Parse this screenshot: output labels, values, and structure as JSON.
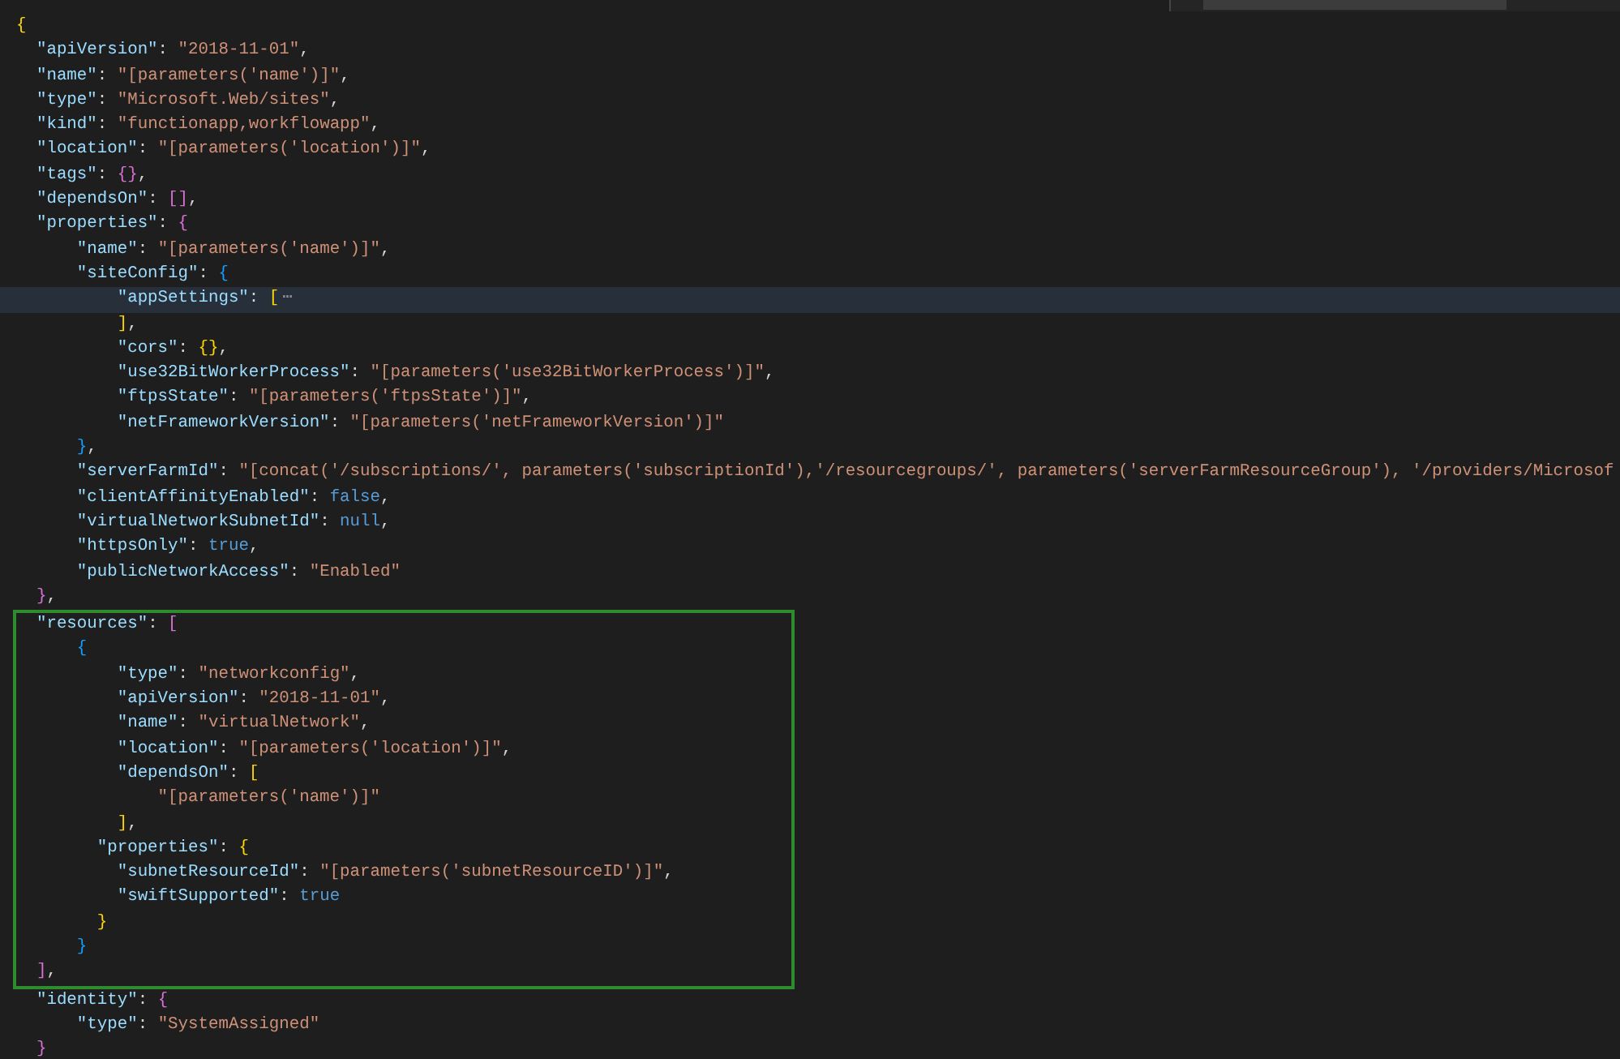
{
  "editor": {
    "lines_before": [
      {
        "current": false,
        "tokens": [
          {
            "kind": "b1",
            "text": "{"
          }
        ]
      },
      {
        "current": false,
        "tokens": [
          {
            "kind": "key",
            "text": "  \"apiVersion\""
          },
          {
            "kind": "p",
            "text": ": "
          },
          {
            "kind": "str",
            "text": "\"2018-11-01\""
          },
          {
            "kind": "p",
            "text": ","
          }
        ]
      },
      {
        "current": false,
        "tokens": [
          {
            "kind": "key",
            "text": "  \"name\""
          },
          {
            "kind": "p",
            "text": ": "
          },
          {
            "kind": "str",
            "text": "\"[parameters('name')]\""
          },
          {
            "kind": "p",
            "text": ","
          }
        ]
      },
      {
        "current": false,
        "tokens": [
          {
            "kind": "key",
            "text": "  \"type\""
          },
          {
            "kind": "p",
            "text": ": "
          },
          {
            "kind": "str",
            "text": "\"Microsoft.Web/sites\""
          },
          {
            "kind": "p",
            "text": ","
          }
        ]
      },
      {
        "current": false,
        "tokens": [
          {
            "kind": "key",
            "text": "  \"kind\""
          },
          {
            "kind": "p",
            "text": ": "
          },
          {
            "kind": "str",
            "text": "\"functionapp,workflowapp\""
          },
          {
            "kind": "p",
            "text": ","
          }
        ]
      },
      {
        "current": false,
        "tokens": [
          {
            "kind": "key",
            "text": "  \"location\""
          },
          {
            "kind": "p",
            "text": ": "
          },
          {
            "kind": "str",
            "text": "\"[parameters('location')]\""
          },
          {
            "kind": "p",
            "text": ","
          }
        ]
      },
      {
        "current": false,
        "tokens": [
          {
            "kind": "key",
            "text": "  \"tags\""
          },
          {
            "kind": "p",
            "text": ": "
          },
          {
            "kind": "b2",
            "text": "{}"
          },
          {
            "kind": "p",
            "text": ","
          }
        ]
      },
      {
        "current": false,
        "tokens": [
          {
            "kind": "key",
            "text": "  \"dependsOn\""
          },
          {
            "kind": "p",
            "text": ": "
          },
          {
            "kind": "b2",
            "text": "[]"
          },
          {
            "kind": "p",
            "text": ","
          }
        ]
      },
      {
        "current": false,
        "tokens": [
          {
            "kind": "key",
            "text": "  \"properties\""
          },
          {
            "kind": "p",
            "text": ": "
          },
          {
            "kind": "b2",
            "text": "{"
          }
        ]
      },
      {
        "current": false,
        "tokens": [
          {
            "kind": "key",
            "text": "      \"name\""
          },
          {
            "kind": "p",
            "text": ": "
          },
          {
            "kind": "str",
            "text": "\"[parameters('name')]\""
          },
          {
            "kind": "p",
            "text": ","
          }
        ]
      },
      {
        "current": false,
        "tokens": [
          {
            "kind": "key",
            "text": "      \"siteConfig\""
          },
          {
            "kind": "p",
            "text": ": "
          },
          {
            "kind": "b3",
            "text": "{"
          }
        ]
      },
      {
        "current": true,
        "tokens": [
          {
            "kind": "key",
            "text": "          \"appSettings\""
          },
          {
            "kind": "p",
            "text": ": "
          },
          {
            "kind": "b1",
            "text": "["
          },
          {
            "kind": "fold",
            "text": "⋯"
          }
        ]
      },
      {
        "current": false,
        "tokens": [
          {
            "kind": "b1",
            "text": "          ]"
          },
          {
            "kind": "p",
            "text": ","
          }
        ]
      },
      {
        "current": false,
        "tokens": [
          {
            "kind": "key",
            "text": "          \"cors\""
          },
          {
            "kind": "p",
            "text": ": "
          },
          {
            "kind": "b1",
            "text": "{}"
          },
          {
            "kind": "p",
            "text": ","
          }
        ]
      },
      {
        "current": false,
        "tokens": [
          {
            "kind": "key",
            "text": "          \"use32BitWorkerProcess\""
          },
          {
            "kind": "p",
            "text": ": "
          },
          {
            "kind": "str",
            "text": "\"[parameters('use32BitWorkerProcess')]\""
          },
          {
            "kind": "p",
            "text": ","
          }
        ]
      },
      {
        "current": false,
        "tokens": [
          {
            "kind": "key",
            "text": "          \"ftpsState\""
          },
          {
            "kind": "p",
            "text": ": "
          },
          {
            "kind": "str",
            "text": "\"[parameters('ftpsState')]\""
          },
          {
            "kind": "p",
            "text": ","
          }
        ]
      },
      {
        "current": false,
        "tokens": [
          {
            "kind": "key",
            "text": "          \"netFrameworkVersion\""
          },
          {
            "kind": "p",
            "text": ": "
          },
          {
            "kind": "str",
            "text": "\"[parameters('netFrameworkVersion')]\""
          }
        ]
      },
      {
        "current": false,
        "tokens": [
          {
            "kind": "b3",
            "text": "      }"
          },
          {
            "kind": "p",
            "text": ","
          }
        ]
      },
      {
        "current": false,
        "tokens": [
          {
            "kind": "key",
            "text": "      \"serverFarmId\""
          },
          {
            "kind": "p",
            "text": ": "
          },
          {
            "kind": "str",
            "text": "\"[concat('/subscriptions/', parameters('subscriptionId'),'/resourcegroups/', parameters('serverFarmResourceGroup'), '/providers/Microsof"
          }
        ]
      },
      {
        "current": false,
        "tokens": [
          {
            "kind": "key",
            "text": "      \"clientAffinityEnabled\""
          },
          {
            "kind": "p",
            "text": ": "
          },
          {
            "kind": "kw",
            "text": "false"
          },
          {
            "kind": "p",
            "text": ","
          }
        ]
      },
      {
        "current": false,
        "tokens": [
          {
            "kind": "key",
            "text": "      \"virtualNetworkSubnetId\""
          },
          {
            "kind": "p",
            "text": ": "
          },
          {
            "kind": "kw",
            "text": "null"
          },
          {
            "kind": "p",
            "text": ","
          }
        ]
      },
      {
        "current": false,
        "tokens": [
          {
            "kind": "key",
            "text": "      \"httpsOnly\""
          },
          {
            "kind": "p",
            "text": ": "
          },
          {
            "kind": "kw",
            "text": "true"
          },
          {
            "kind": "p",
            "text": ","
          }
        ]
      },
      {
        "current": false,
        "tokens": [
          {
            "kind": "key",
            "text": "      \"publicNetworkAccess\""
          },
          {
            "kind": "p",
            "text": ": "
          },
          {
            "kind": "str",
            "text": "\"Enabled\""
          }
        ]
      },
      {
        "current": false,
        "tokens": [
          {
            "kind": "b2",
            "text": "  }"
          },
          {
            "kind": "p",
            "text": ","
          }
        ]
      }
    ],
    "highlight_box": {
      "lines": [
        {
          "current": false,
          "tokens": [
            {
              "kind": "key",
              "text": "  \"resources\""
            },
            {
              "kind": "p",
              "text": ": "
            },
            {
              "kind": "b2",
              "text": "["
            }
          ]
        },
        {
          "current": false,
          "tokens": [
            {
              "kind": "b3",
              "text": "      {"
            }
          ]
        },
        {
          "current": false,
          "tokens": [
            {
              "kind": "key",
              "text": "          \"type\""
            },
            {
              "kind": "p",
              "text": ": "
            },
            {
              "kind": "str",
              "text": "\"networkconfig\""
            },
            {
              "kind": "p",
              "text": ","
            }
          ]
        },
        {
          "current": false,
          "tokens": [
            {
              "kind": "key",
              "text": "          \"apiVersion\""
            },
            {
              "kind": "p",
              "text": ": "
            },
            {
              "kind": "str",
              "text": "\"2018-11-01\""
            },
            {
              "kind": "p",
              "text": ","
            }
          ]
        },
        {
          "current": false,
          "tokens": [
            {
              "kind": "key",
              "text": "          \"name\""
            },
            {
              "kind": "p",
              "text": ": "
            },
            {
              "kind": "str",
              "text": "\"virtualNetwork\""
            },
            {
              "kind": "p",
              "text": ","
            }
          ]
        },
        {
          "current": false,
          "tokens": [
            {
              "kind": "key",
              "text": "          \"location\""
            },
            {
              "kind": "p",
              "text": ": "
            },
            {
              "kind": "str",
              "text": "\"[parameters('location')]\""
            },
            {
              "kind": "p",
              "text": ","
            }
          ]
        },
        {
          "current": false,
          "tokens": [
            {
              "kind": "key",
              "text": "          \"dependsOn\""
            },
            {
              "kind": "p",
              "text": ": "
            },
            {
              "kind": "b1",
              "text": "["
            }
          ]
        },
        {
          "current": false,
          "tokens": [
            {
              "kind": "str",
              "text": "              \"[parameters('name')]\""
            }
          ]
        },
        {
          "current": false,
          "tokens": [
            {
              "kind": "b1",
              "text": "          ]"
            },
            {
              "kind": "p",
              "text": ","
            }
          ]
        },
        {
          "current": false,
          "tokens": [
            {
              "kind": "key",
              "text": "        \"properties\""
            },
            {
              "kind": "p",
              "text": ": "
            },
            {
              "kind": "b1",
              "text": "{"
            }
          ]
        },
        {
          "current": false,
          "tokens": [
            {
              "kind": "key",
              "text": "          \"subnetResourceId\""
            },
            {
              "kind": "p",
              "text": ": "
            },
            {
              "kind": "str",
              "text": "\"[parameters('subnetResourceID')]\""
            },
            {
              "kind": "p",
              "text": ","
            }
          ]
        },
        {
          "current": false,
          "tokens": [
            {
              "kind": "key",
              "text": "          \"swiftSupported\""
            },
            {
              "kind": "p",
              "text": ": "
            },
            {
              "kind": "kw",
              "text": "true"
            }
          ]
        },
        {
          "current": false,
          "tokens": [
            {
              "kind": "b1",
              "text": "        }"
            }
          ]
        },
        {
          "current": false,
          "tokens": [
            {
              "kind": "b3",
              "text": "      }"
            }
          ]
        },
        {
          "current": false,
          "tokens": [
            {
              "kind": "b2",
              "text": "  ]"
            },
            {
              "kind": "p",
              "text": ","
            }
          ]
        }
      ]
    },
    "lines_after": [
      {
        "current": false,
        "tokens": [
          {
            "kind": "key",
            "text": "  \"identity\""
          },
          {
            "kind": "p",
            "text": ": "
          },
          {
            "kind": "b2",
            "text": "{"
          }
        ]
      },
      {
        "current": false,
        "tokens": [
          {
            "kind": "key",
            "text": "      \"type\""
          },
          {
            "kind": "p",
            "text": ": "
          },
          {
            "kind": "str",
            "text": "\"SystemAssigned\""
          }
        ]
      },
      {
        "current": false,
        "tokens": [
          {
            "kind": "b2",
            "text": "  }"
          }
        ]
      }
    ]
  }
}
